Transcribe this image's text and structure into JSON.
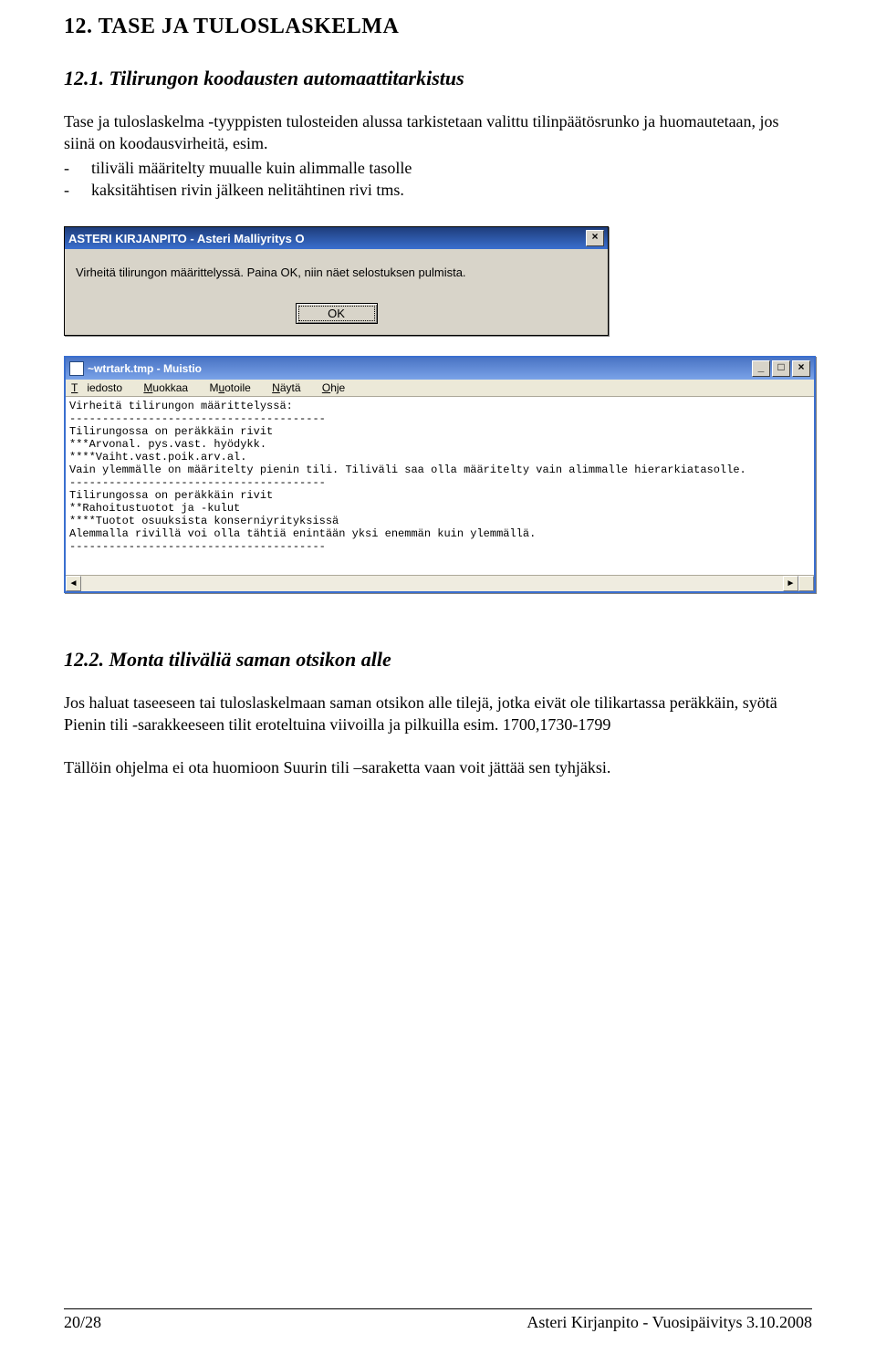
{
  "headings": {
    "main": "12. TASE JA TULOSLASKELMA",
    "s1": "12.1. Tilirungon koodausten automaattitarkistus",
    "s2": "12.2. Monta tiliväliä saman otsikon alle"
  },
  "paragraphs": {
    "p1": "Tase ja tuloslaskelma -tyyppisten tulosteiden alussa tarkistetaan valittu tilinpäätösrunko ja huomautetaan, jos siinä on koodausvirheitä, esim.",
    "b1": "tiliväli määritelty muualle kuin alimmalle tasolle",
    "b2": "kaksitähtisen rivin jälkeen nelitähtinen rivi tms.",
    "p2": "Jos haluat taseeseen tai tuloslaskelmaan saman otsikon alle tilejä, jotka eivät ole tilikartassa peräkkäin, syötä Pienin tili -sarakkeeseen tilit eroteltuina viivoilla ja pilkuilla esim. 1700,1730-1799",
    "p3": "Tällöin ohjelma ei ota huomioon Suurin tili –saraketta vaan voit jättää sen tyhjäksi."
  },
  "dialog": {
    "title": "ASTERI KIRJANPITO - Asteri Malliyritys O",
    "message": "Virheitä tilirungon määrittelyssä. Paina OK, niin näet selostuksen pulmista.",
    "ok": "OK",
    "close": "×"
  },
  "notepad": {
    "title": "~wtrtark.tmp - Muistio",
    "menu": {
      "file": "Tiedosto",
      "edit": "Muokkaa",
      "format": "Muotoile",
      "view": "Näytä",
      "help": "Ohje"
    },
    "min": "_",
    "max": "□",
    "close": "×",
    "content": "Virheitä tilirungon määrittelyssä:\n---------------------------------------\nTilirungossa on peräkkäin rivit\n***Arvonal. pys.vast. hyödykk.\n****Vaiht.vast.poik.arv.al.\nVain ylemmälle on määritelty pienin tili. Tiliväli saa olla määritelty vain alimmalle hierarkiatasolle.\n---------------------------------------\nTilirungossa on peräkkäin rivit\n**Rahoitustuotot ja -kulut\n****Tuotot osuuksista konserniyrityksissä\nAlemmalla rivillä voi olla tähtiä enintään yksi enemmän kuin ylemmällä.\n---------------------------------------"
  },
  "footer": {
    "page": "20/28",
    "doc": "Asteri Kirjanpito - Vuosipäivitys 3.10.2008"
  }
}
